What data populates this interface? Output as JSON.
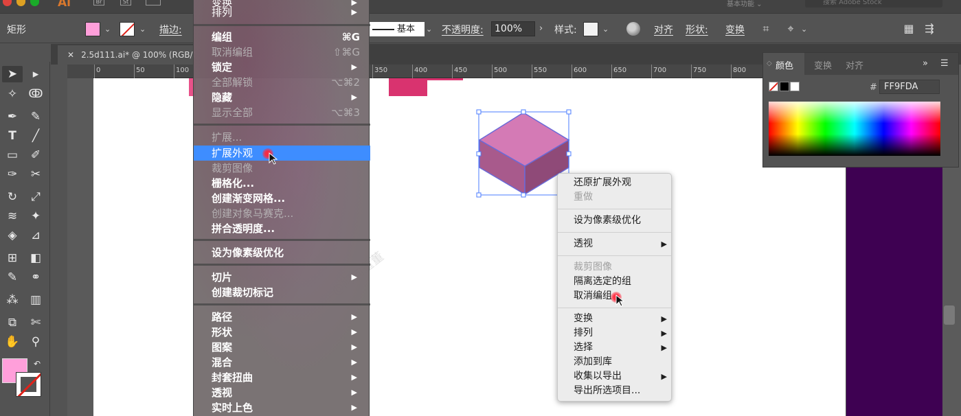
{
  "app": {
    "logo": "Ai",
    "sys_icons": [
      "Br",
      "St"
    ],
    "workspace": "基本功能",
    "stock_search_placeholder": "搜索 Adobe Stock"
  },
  "control_bar": {
    "object_type": "矩形",
    "fill_color": "#FF9FDA",
    "stroke_label": "描边:",
    "stroke_style": "基本",
    "opacity_label": "不透明度:",
    "opacity_value": "100%",
    "style_label": "样式:",
    "align_label": "对齐",
    "shape_label": "形状:",
    "transform_label": "变换"
  },
  "document": {
    "tab_title": "2.5d111.ai* @ 100% (RGB/GPU"
  },
  "ruler": {
    "ticks": [
      "0",
      "50",
      "100",
      "350",
      "400",
      "450",
      "500",
      "550",
      "600",
      "650",
      "700",
      "750",
      "800"
    ]
  },
  "main_menu": {
    "top_partial": "变换",
    "items": [
      {
        "label": "排列",
        "shortcut": "",
        "submenu": true,
        "disabled": false
      },
      {
        "label": "编组",
        "shortcut": "⌘G",
        "submenu": false,
        "disabled": false
      },
      {
        "label": "取消编组",
        "shortcut": "⇧⌘G",
        "submenu": false,
        "disabled": true
      },
      {
        "label": "锁定",
        "shortcut": "",
        "submenu": true,
        "disabled": false
      },
      {
        "label": "全部解锁",
        "shortcut": "⌥⌘2",
        "submenu": false,
        "disabled": true
      },
      {
        "label": "隐藏",
        "shortcut": "",
        "submenu": true,
        "disabled": false
      },
      {
        "label": "显示全部",
        "shortcut": "⌥⌘3",
        "submenu": false,
        "disabled": true
      },
      {
        "label": "扩展...",
        "shortcut": "",
        "submenu": false,
        "disabled": true
      },
      {
        "label": "扩展外观",
        "shortcut": "",
        "submenu": false,
        "disabled": false,
        "highlighted": true
      },
      {
        "label": "裁剪图像",
        "shortcut": "",
        "submenu": false,
        "disabled": true
      },
      {
        "label": "栅格化...",
        "shortcut": "",
        "submenu": false,
        "disabled": false
      },
      {
        "label": "创建渐变网格...",
        "shortcut": "",
        "submenu": false,
        "disabled": false
      },
      {
        "label": "创建对象马赛克...",
        "shortcut": "",
        "submenu": false,
        "disabled": true
      },
      {
        "label": "拼合透明度...",
        "shortcut": "",
        "submenu": false,
        "disabled": false
      },
      {
        "label": "设为像素级优化",
        "shortcut": "",
        "submenu": false,
        "disabled": false
      },
      {
        "label": "切片",
        "shortcut": "",
        "submenu": true,
        "disabled": false
      },
      {
        "label": "创建裁切标记",
        "shortcut": "",
        "submenu": false,
        "disabled": false
      },
      {
        "label": "路径",
        "shortcut": "",
        "submenu": true,
        "disabled": false
      },
      {
        "label": "形状",
        "shortcut": "",
        "submenu": true,
        "disabled": false
      },
      {
        "label": "图案",
        "shortcut": "",
        "submenu": true,
        "disabled": false
      },
      {
        "label": "混合",
        "shortcut": "",
        "submenu": true,
        "disabled": false
      },
      {
        "label": "封套扭曲",
        "shortcut": "",
        "submenu": true,
        "disabled": false
      },
      {
        "label": "透视",
        "shortcut": "",
        "submenu": true,
        "disabled": false
      },
      {
        "label": "实时上色",
        "shortcut": "",
        "submenu": true,
        "disabled": false
      }
    ]
  },
  "context_menu": {
    "items": [
      {
        "label": "还原扩展外观",
        "disabled": false,
        "submenu": false
      },
      {
        "label": "重做",
        "disabled": true,
        "submenu": false
      },
      {
        "label": "设为像素级优化",
        "disabled": false,
        "submenu": false
      },
      {
        "label": "透视",
        "disabled": false,
        "submenu": true
      },
      {
        "label": "裁剪图像",
        "disabled": true,
        "submenu": false
      },
      {
        "label": "隔离选定的组",
        "disabled": false,
        "submenu": false
      },
      {
        "label": "取消编组",
        "disabled": false,
        "submenu": false
      },
      {
        "label": "变换",
        "disabled": false,
        "submenu": true
      },
      {
        "label": "排列",
        "disabled": false,
        "submenu": true
      },
      {
        "label": "选择",
        "disabled": false,
        "submenu": true
      },
      {
        "label": "添加到库",
        "disabled": false,
        "submenu": false
      },
      {
        "label": "收集以导出",
        "disabled": false,
        "submenu": true
      },
      {
        "label": "导出所选项目...",
        "disabled": false,
        "submenu": false
      }
    ]
  },
  "color_panel": {
    "tabs": [
      "颜色",
      "变换",
      "对齐"
    ],
    "hex_label": "#",
    "hex_value": "FF9FDA"
  },
  "canvas": {
    "cube_top": "#d47ab5",
    "cube_left": "#a85a8c",
    "cube_right": "#8f4a78",
    "purple_panel": "#3e0152",
    "watermark": "@阿向董董"
  },
  "colors": {
    "menu_highlight": "#3e8dff",
    "accent_pink": "#FF9FDA"
  }
}
